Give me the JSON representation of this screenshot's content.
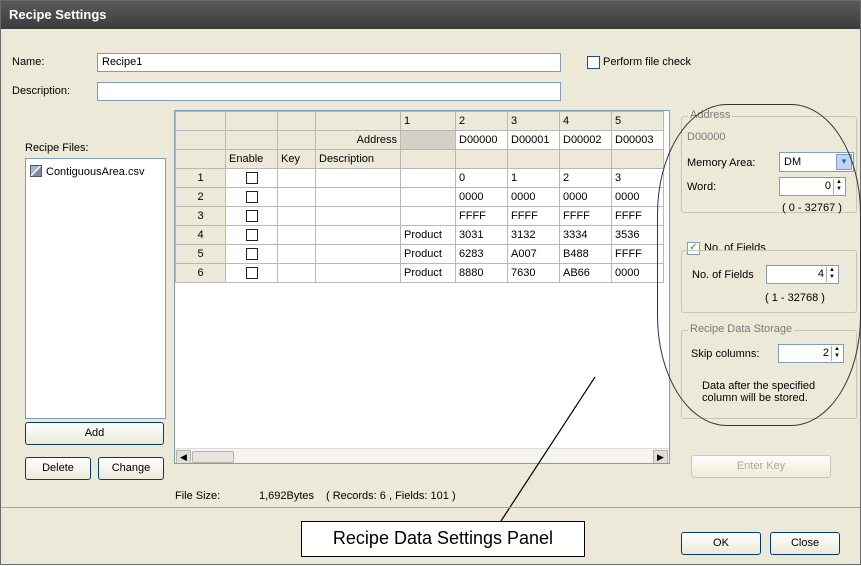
{
  "window": {
    "title": "Recipe Settings"
  },
  "form": {
    "name_label": "Name:",
    "name_value": "Recipe1",
    "description_label": "Description:",
    "description_value": "",
    "perform_file_check_label": "Perform file check",
    "perform_file_check_checked": false
  },
  "recipe_files": {
    "label": "Recipe Files:",
    "items": [
      "ContiguousArea.csv"
    ],
    "add_button": "Add",
    "delete_button": "Delete",
    "change_button": "Change"
  },
  "grid": {
    "col_numbers": [
      "1",
      "2",
      "3",
      "4",
      "5"
    ],
    "address_label": "Address",
    "addresses": [
      "",
      "D00000",
      "D00001",
      "D00002",
      "D00003"
    ],
    "headers": {
      "enable": "Enable",
      "key": "Key",
      "description": "Description"
    },
    "rows": [
      {
        "num": "1",
        "desc": "",
        "values": [
          "",
          "0",
          "1",
          "2",
          "3"
        ]
      },
      {
        "num": "2",
        "desc": "",
        "values": [
          "",
          "0000",
          "0000",
          "0000",
          "0000"
        ]
      },
      {
        "num": "3",
        "desc": "",
        "values": [
          "",
          "FFFF",
          "FFFF",
          "FFFF",
          "FFFF"
        ]
      },
      {
        "num": "4",
        "desc": "",
        "values": [
          "Product",
          "3031",
          "3132",
          "3334",
          "3536"
        ]
      },
      {
        "num": "5",
        "desc": "",
        "values": [
          "Product",
          "6283",
          "A007",
          "B488",
          "FFFF"
        ]
      },
      {
        "num": "6",
        "desc": "",
        "values": [
          "Product",
          "8880",
          "7630",
          "AB66",
          "0000"
        ]
      }
    ]
  },
  "file_info": {
    "label": "File Size:",
    "size": "1,692Bytes",
    "summary": "( Records: 6 , Fields: 101 )"
  },
  "address_panel": {
    "group_title": "Address",
    "current_address": "D00000",
    "memory_area_label": "Memory Area:",
    "memory_area_value": "DM",
    "word_label": "Word:",
    "word_value": "0",
    "word_range": "( 0 - 32767 )",
    "fields_checkbox_label": "No. of Fields",
    "fields_checked": true,
    "fields_label": "No. of Fields",
    "fields_value": "4",
    "fields_range": "( 1 - 32768 )",
    "storage_group_title": "Recipe Data Storage",
    "skip_label": "Skip columns:",
    "skip_value": "2",
    "storage_note": "Data after the specified column will be stored.",
    "enter_key_button": "Enter Key"
  },
  "footer": {
    "ok_button": "OK",
    "close_button": "Close"
  },
  "callout": {
    "text": "Recipe Data Settings Panel"
  }
}
